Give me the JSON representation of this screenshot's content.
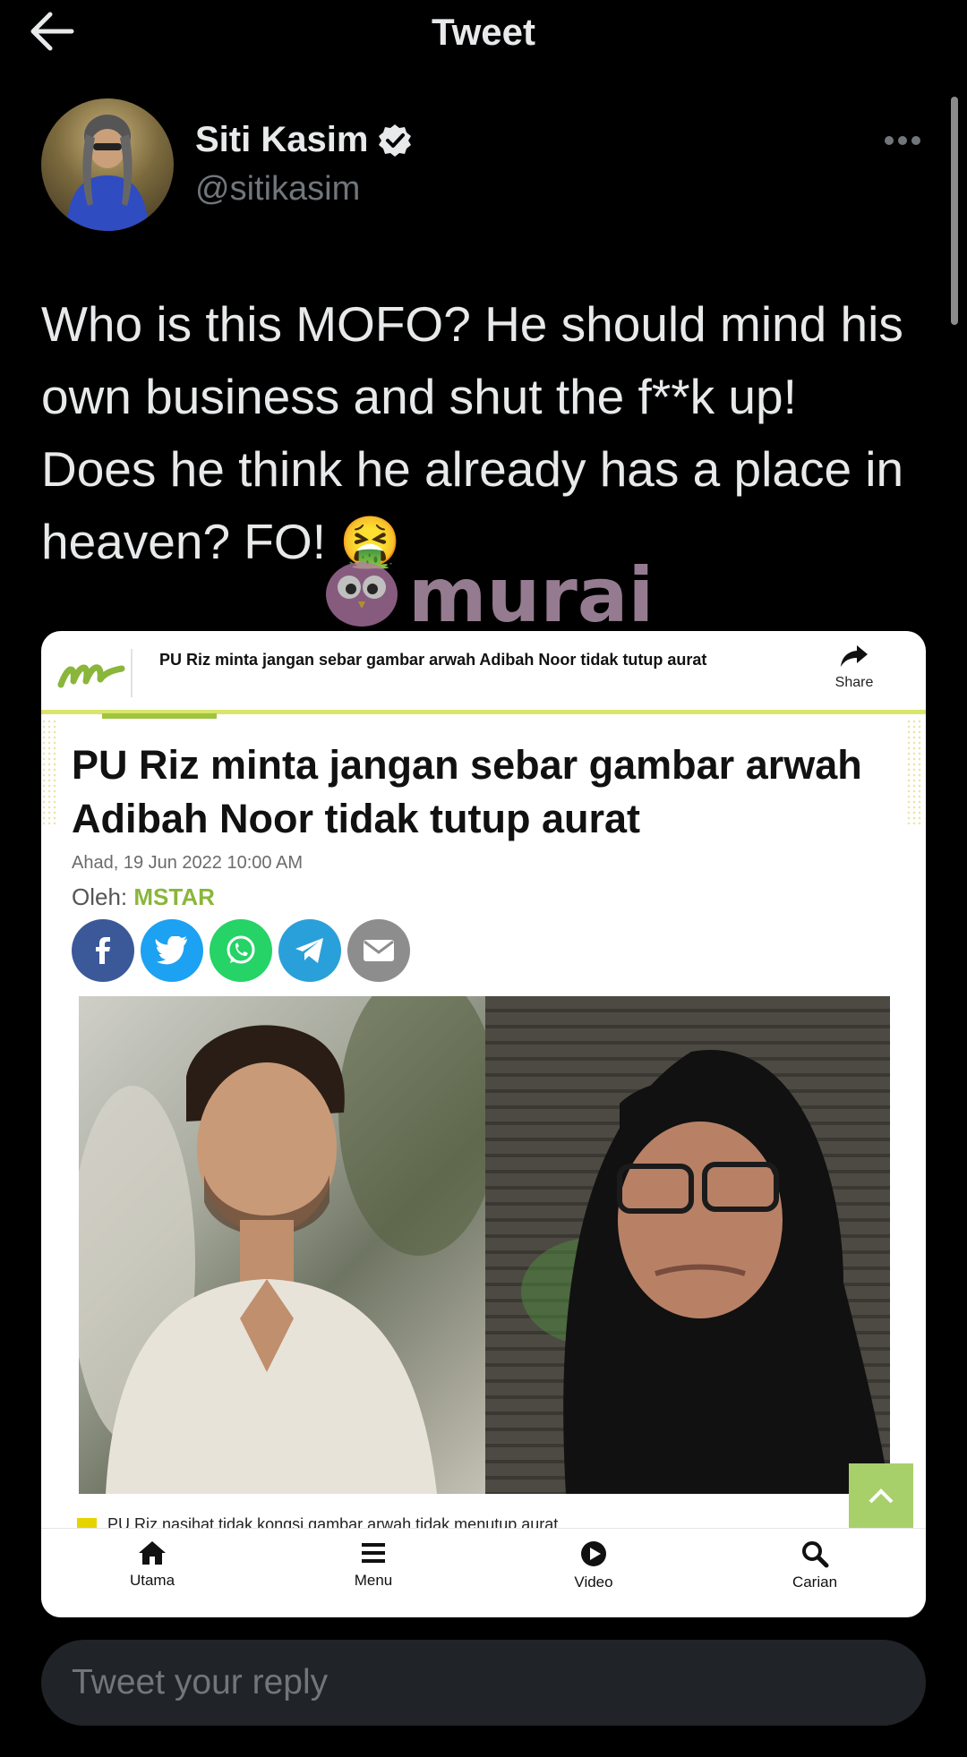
{
  "header": {
    "title": "Tweet",
    "back_icon": "arrow-left-icon"
  },
  "author": {
    "name": "Siti Kasim",
    "handle": "@sitikasim",
    "verified": true
  },
  "tweet": {
    "text": "Who is this MOFO? He should mind his own business and shut the f**k up! Does he think he already has a place in heaven? FO! 🤮"
  },
  "watermark": {
    "text": "murai"
  },
  "card": {
    "header_title": "PU Riz minta jangan sebar gambar arwah Adibah Noor tidak tutup aurat",
    "share_label": "Share",
    "headline": "PU Riz minta jangan sebar gambar arwah Adibah Noor tidak tutup aurat",
    "date": "Ahad, 19 Jun 2022 10:00 AM",
    "author_label": "Oleh:",
    "author_name": "MSTAR",
    "share_icons": [
      "facebook-icon",
      "twitter-icon",
      "whatsapp-icon",
      "telegram-icon",
      "email-icon"
    ],
    "related": "PU Riz nasihat tidak kongsi gambar arwah tidak menutup aurat",
    "nav": [
      {
        "label": "Utama",
        "icon": "home-icon"
      },
      {
        "label": "Menu",
        "icon": "menu-icon"
      },
      {
        "label": "Video",
        "icon": "play-icon"
      },
      {
        "label": "Carian",
        "icon": "search-icon"
      }
    ],
    "colors": {
      "accent_green": "#8ab63b",
      "lime_rule": "#d9e56b",
      "back_to_top": "#a8d06a"
    }
  },
  "reply": {
    "placeholder": "Tweet your reply"
  }
}
